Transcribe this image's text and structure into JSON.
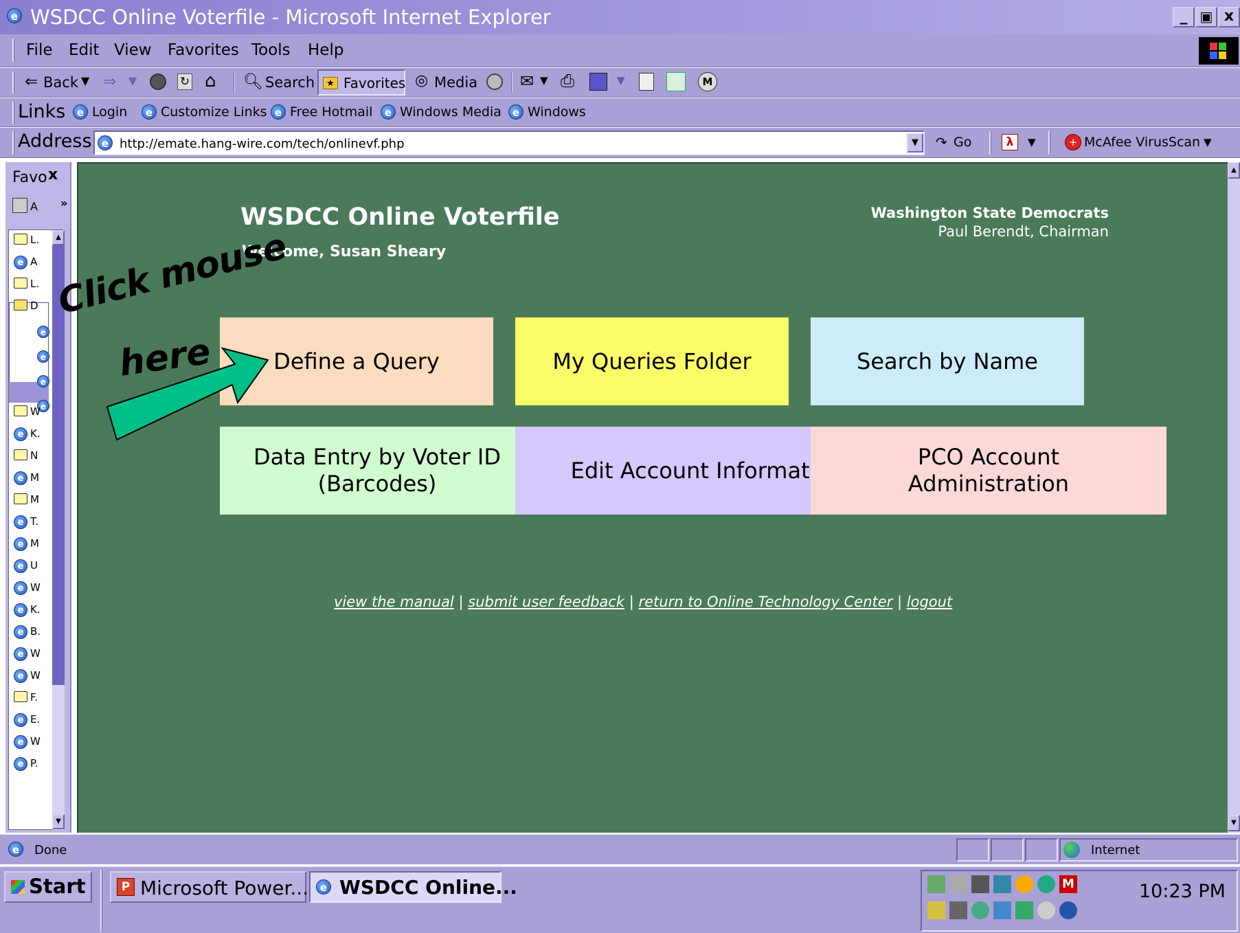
{
  "window": {
    "title": "WSDCC Online Voterfile - Microsoft Internet Explorer",
    "controls": [
      "_",
      "▣",
      "x"
    ]
  },
  "menu": [
    "File",
    "Edit",
    "View",
    "Favorites",
    "Tools",
    "Help"
  ],
  "toolbar": {
    "back": "Back",
    "search": "Search",
    "favorites": "Favorites",
    "media": "Media"
  },
  "links_bar": {
    "label": "Links",
    "items": [
      "Login",
      "Customize Links",
      "Free Hotmail",
      "Windows Media",
      "Windows"
    ]
  },
  "address_bar": {
    "label": "Address",
    "url": "http://emate.hang-wire.com/tech/onlinevf.php",
    "go": "Go",
    "mcafee": "McAfee VirusScan"
  },
  "favorites_pane": {
    "title": "Favo",
    "close": "x",
    "add": "A",
    "items": [
      {
        "icon": "folder",
        "label": "L."
      },
      {
        "icon": "ie",
        "label": "A"
      },
      {
        "icon": "folder",
        "label": "L."
      },
      {
        "icon": "folder-open",
        "label": "D"
      },
      {
        "icon": "folder",
        "label": "W"
      },
      {
        "icon": "ie",
        "label": "K."
      },
      {
        "icon": "folder",
        "label": "N"
      },
      {
        "icon": "ie",
        "label": "M"
      },
      {
        "icon": "folder",
        "label": "M"
      },
      {
        "icon": "ie",
        "label": "T."
      },
      {
        "icon": "ie",
        "label": "M"
      },
      {
        "icon": "ie",
        "label": "U"
      },
      {
        "icon": "ie",
        "label": "W"
      },
      {
        "icon": "ie",
        "label": "K."
      },
      {
        "icon": "ie",
        "label": "B."
      },
      {
        "icon": "ie",
        "label": "W"
      },
      {
        "icon": "ie",
        "label": "W"
      },
      {
        "icon": "folder",
        "label": "F."
      },
      {
        "icon": "ie",
        "label": "E."
      },
      {
        "icon": "ie",
        "label": "W"
      },
      {
        "icon": "ie",
        "label": "P."
      }
    ]
  },
  "page": {
    "title": "WSDCC Online Voterfile",
    "welcome": "Welcome, Susan Sheary",
    "org": "Washington State Democrats",
    "chair": "Paul Berendt, Chairman",
    "tiles": [
      {
        "label": "Define a Query",
        "color": "#fcdcbe"
      },
      {
        "label": "My Queries Folder",
        "color": "#fcfc68"
      },
      {
        "label": "Search by Name",
        "color": "#ccecfc"
      },
      {
        "label": "Data Entry by Voter ID (Barcodes)",
        "color": "#d0fcd0"
      },
      {
        "label": "Edit Account Information",
        "color": "#d4c8fc"
      },
      {
        "label": "PCO Account Administration",
        "color": "#fcd8d8"
      }
    ],
    "footer_links": [
      "view the manual",
      "submit user feedback",
      "return to Online Technology Center",
      "logout"
    ],
    "background": "#4a7a5a"
  },
  "annotation": {
    "line1": "Click mouse",
    "line2": "here"
  },
  "status_bar": {
    "text": "Done",
    "zone": "Internet"
  },
  "taskbar": {
    "start": "Start",
    "tasks": [
      "Microsoft Power...",
      "WSDCC Online..."
    ],
    "clock": "10:23 PM"
  }
}
